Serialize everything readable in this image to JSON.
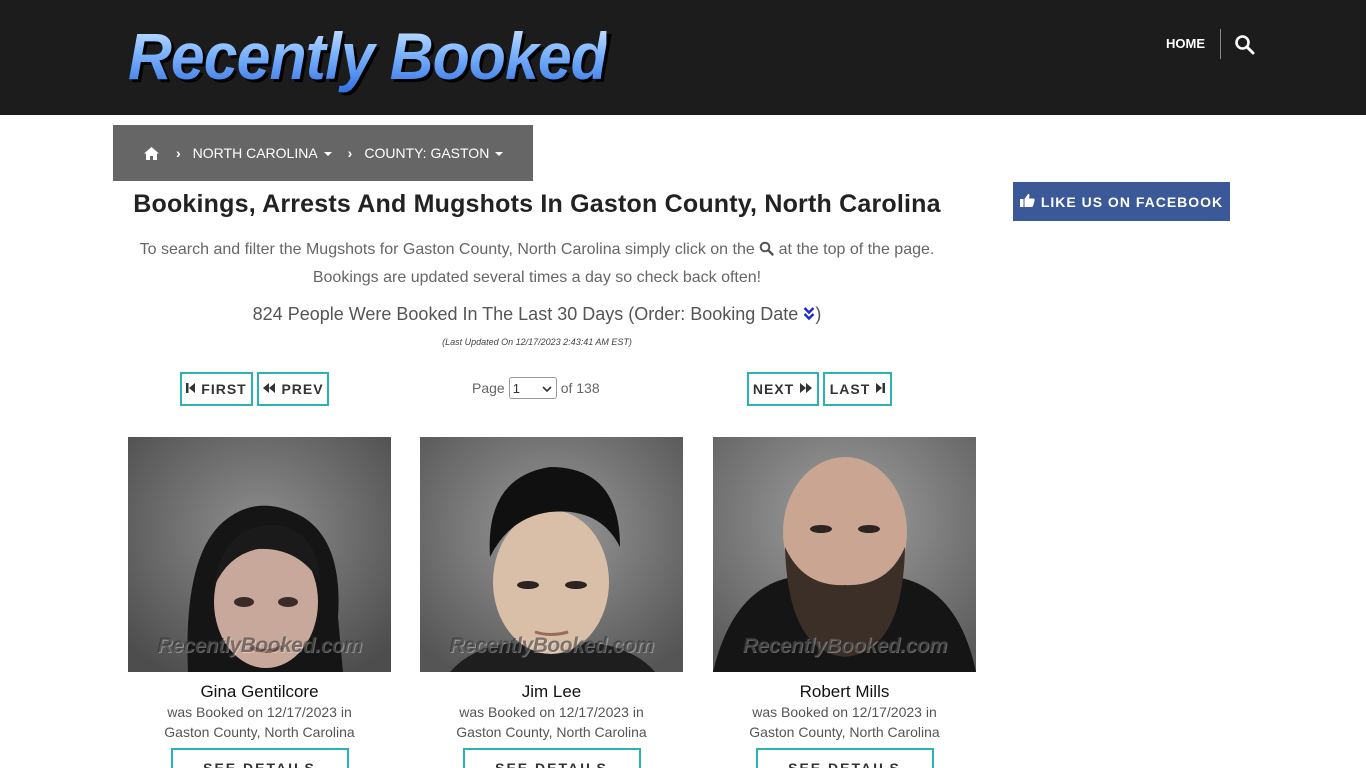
{
  "header": {
    "logo_text": "Recently Booked",
    "nav_home": "HOME"
  },
  "breadcrumb": {
    "state": "NORTH CAROLINA",
    "county": "COUNTY: GASTON"
  },
  "page": {
    "title": "Bookings, Arrests And Mugshots In Gaston County, North Carolina",
    "intro_part1": "To search and filter the Mugshots for Gaston County, North Carolina simply click on the",
    "intro_part2": "at the top of the page.",
    "intro_line2": "Bookings are updated several times a day so check back often!",
    "count_text": "824 People Were Booked In The Last 30 Days (Order: Booking Date",
    "count_close": ")",
    "updated": "(Last Updated On 12/17/2023 2:43:41 AM EST)"
  },
  "pagination": {
    "first": "FIRST",
    "prev": "PREV",
    "next": "NEXT",
    "last": "LAST",
    "page_label": "Page",
    "current_page": "1",
    "of_label": "of 138"
  },
  "facebook": {
    "label": "LIKE US ON FACEBOOK"
  },
  "cards": [
    {
      "name": "Gina Gentilcore",
      "booked": "was Booked on 12/17/2023 in",
      "location": "Gaston County, North Carolina",
      "watermark": "RecentlyBooked.com",
      "button": "SEE DETAILS"
    },
    {
      "name": "Jim Lee",
      "booked": "was Booked on 12/17/2023 in",
      "location": "Gaston County, North Carolina",
      "watermark": "RecentlyBooked.com",
      "button": "SEE DETAILS"
    },
    {
      "name": "Robert Mills",
      "booked": "was Booked on 12/17/2023 in",
      "location": "Gaston County, North Carolina",
      "watermark": "RecentlyBooked.com",
      "button": "SEE DETAILS"
    }
  ],
  "colors": {
    "header_bg": "#1c1c1c",
    "breadcrumb_bg": "#666666",
    "accent_teal": "#2bb3b3",
    "facebook_blue": "#3b5998"
  },
  "icons": [
    "home-icon",
    "search-icon",
    "chevron-right-icon",
    "caret-down-icon",
    "double-chevron-down-icon",
    "step-backward-icon",
    "backward-icon",
    "forward-icon",
    "step-forward-icon",
    "thumbs-up-icon"
  ]
}
